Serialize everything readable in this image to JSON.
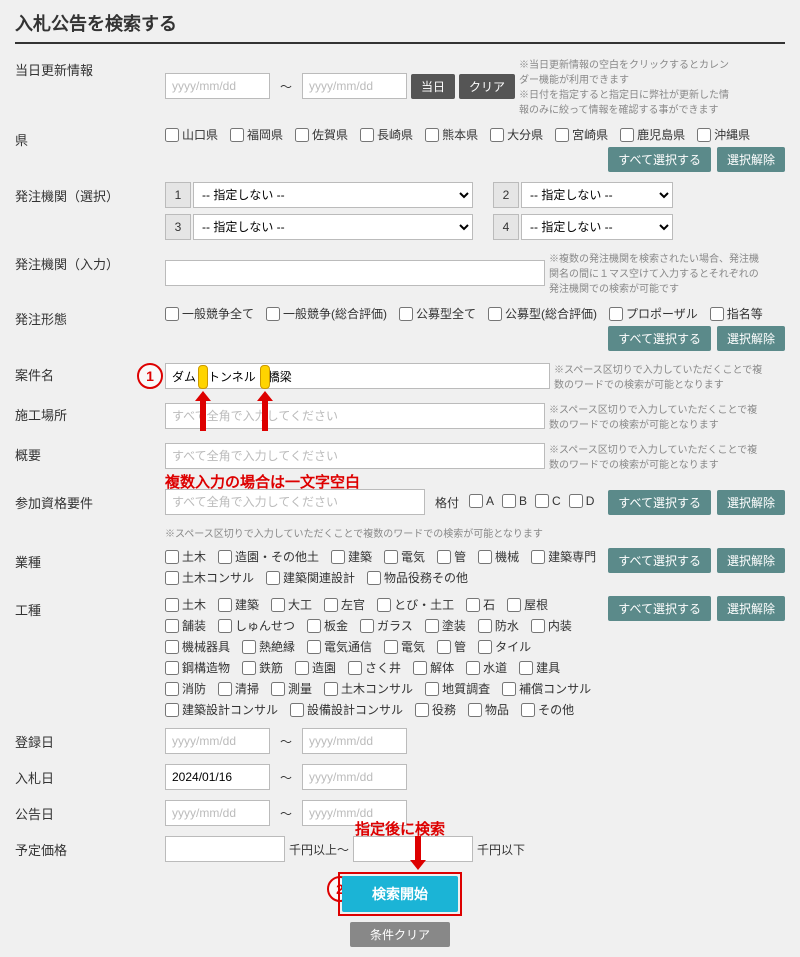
{
  "page_title": "入札公告を検索する",
  "update_info": {
    "label": "当日更新情報",
    "from_ph": "yyyy/mm/dd",
    "to_ph": "yyyy/mm/dd",
    "btn_today": "当日",
    "btn_clear": "クリア",
    "note1": "※当日更新情報の空白をクリックするとカレンダー機能が利用できます",
    "note2": "※日付を指定すると指定日に弊社が更新した情報のみに絞って情報を確認する事ができます"
  },
  "prefecture": {
    "label": "県",
    "items": [
      "山口県",
      "福岡県",
      "佐賀県",
      "長崎県",
      "熊本県",
      "大分県",
      "宮崎県",
      "鹿児島県",
      "沖縄県"
    ],
    "btn_all": "すべて選択する",
    "btn_clear": "選択解除"
  },
  "agency_sel": {
    "label": "発注機関（選択）",
    "nums": [
      "1",
      "2",
      "3",
      "4"
    ],
    "opt": "-- 指定しない --"
  },
  "agency_in": {
    "label": "発注機関（入力）",
    "note": "※複数の発注機関を検索されたい場合、発注機関名の間に１マス空けて入力するとそれぞれの発注機関での検索が可能です"
  },
  "bid_type": {
    "label": "発注形態",
    "items": [
      "一般競争全て",
      "一般競争(総合評価)",
      "公募型全て",
      "公募型(総合評価)",
      "プロポーザル",
      "指名等"
    ],
    "btn_all": "すべて選択する",
    "btn_clear": "選択解除"
  },
  "project_name": {
    "label": "案件名",
    "value": "ダム　トンネル　橋梁",
    "note": "※スペース区切りで入力していただくことで複数のワードでの検索が可能となります"
  },
  "location": {
    "label": "施工場所",
    "ph": "すべて全角で入力してください",
    "note": "※スペース区切りで入力していただくことで複数のワードでの検索が可能となります"
  },
  "summary": {
    "label": "概要",
    "ph": "すべて全角で入力してください",
    "note": "※スペース区切りで入力していただくことで複数のワードでの検索が可能となります"
  },
  "qualification": {
    "label": "参加資格要件",
    "ph": "すべて全角で入力してください",
    "grade": "格付",
    "grades": [
      "A",
      "B",
      "C",
      "D"
    ],
    "btn_all": "すべて選択する",
    "btn_clear": "選択解除",
    "sub": "※スペース区切りで入力していただくことで複数のワードでの検索が可能となります"
  },
  "industry": {
    "label": "業種",
    "items": [
      "土木",
      "造園・その他土",
      "建築",
      "電気",
      "管",
      "機械",
      "建築専門",
      "土木コンサル",
      "建築関連設計",
      "物品役務その他"
    ],
    "btn_all": "すべて選択する",
    "btn_clear": "選択解除"
  },
  "work_type": {
    "label": "工種",
    "items": [
      "土木",
      "建築",
      "大工",
      "左官",
      "とび・土工",
      "石",
      "屋根",
      "舗装",
      "しゅんせつ",
      "板金",
      "ガラス",
      "塗装",
      "防水",
      "内装",
      "機械器具",
      "熱絶縁",
      "電気通信",
      "電気",
      "管",
      "タイル",
      "鋼構造物",
      "鉄筋",
      "造園",
      "さく井",
      "解体",
      "水道",
      "建具",
      "消防",
      "清掃",
      "測量",
      "土木コンサル",
      "地質調査",
      "補償コンサル",
      "建築設計コンサル",
      "設備設計コンサル",
      "役務",
      "物品",
      "その他"
    ],
    "btn_all": "すべて選択する",
    "btn_clear": "選択解除"
  },
  "reg_date": {
    "label": "登録日",
    "ph": "yyyy/mm/dd"
  },
  "bid_date": {
    "label": "入札日",
    "from": "2024/01/16",
    "ph": "yyyy/mm/dd"
  },
  "notice_date": {
    "label": "公告日",
    "ph": "yyyy/mm/dd"
  },
  "price": {
    "label": "予定価格",
    "unit_from": "千円以上～",
    "unit_to": "千円以下"
  },
  "buttons": {
    "search": "検索開始",
    "clear": "条件クリア"
  },
  "annotations": {
    "multi": "複数入力の場合は一文字空白",
    "after": "指定後に検索"
  }
}
